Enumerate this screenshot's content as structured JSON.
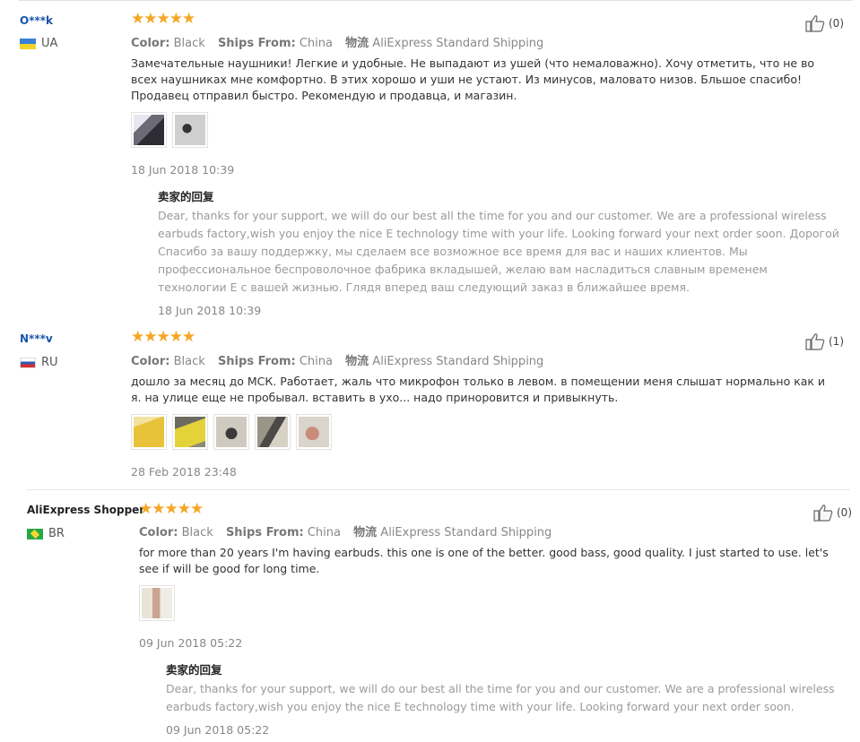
{
  "reviews": [
    {
      "user": "O***k",
      "country": "UA",
      "stars": "★★★★★",
      "color_label": "Color:",
      "color_value": "Black",
      "ships_label": "Ships From:",
      "ships_value": "China",
      "logistics_label": "物流",
      "logistics_value": "AliExpress Standard Shipping",
      "likes": "(0)",
      "text": "Замечательные наушники! Легкие и удобные. Не выпадают из ушей (что немаловажно). Хочу отметить, что не во всех наушниках мне комфортно. В этих хорошо и уши не устают. Из минусов, маловато низов. Бльшое спасибо! Продавец отправил быстро. Рекомендую и продавца, и магазин.",
      "date": "18 Jun 2018 10:39",
      "reply_title": "卖家的回复",
      "reply_text": "Dear, thanks for your support, we will do our best all the time for you and our customer. We are a professional wireless earbuds factory,wish you enjoy the nice E technology time with your life. Looking forward your next order soon. Дорогой Спасибо за вашу поддержку, мы сделаем все возможное все время для вас и наших клиентов. Мы профессиональное беспроволочное фабрика вкладышей, желаю вам насладиться славным временем технологии E с вашей жизнью. Глядя вперед ваш следующий заказ в ближайшее время.",
      "reply_date": "18 Jun 2018 10:39"
    },
    {
      "user": "N***v",
      "country": "RU",
      "stars": "★★★★★",
      "color_label": "Color:",
      "color_value": "Black",
      "ships_label": "Ships From:",
      "ships_value": "China",
      "logistics_label": "物流",
      "logistics_value": "AliExpress Standard Shipping",
      "likes": "(1)",
      "text": "дошло за месяц до МСК. Работает, жаль что микрофон только в левом. в помещении меня слышат нормально как и я. на улице еще не пробывал. вставить в ухо... надо приноровится и привыкнуть.",
      "date": "28 Feb 2018 23:48"
    },
    {
      "user": "AliExpress Shopper",
      "country": "BR",
      "stars": "★★★★★",
      "color_label": "Color:",
      "color_value": "Black",
      "ships_label": "Ships From:",
      "ships_value": "China",
      "logistics_label": "物流",
      "logistics_value": "AliExpress Standard Shipping",
      "likes": "(0)",
      "text": "for more than 20 years I'm having earbuds. this one is one of the better. good bass, good quality. I just started to use. let's see if will be good for long time.",
      "date": "09 Jun 2018 05:22",
      "reply_title": "卖家的回复",
      "reply_text": "Dear, thanks for your support, we will do our best all the time for you and our customer. We are a professional wireless earbuds factory,wish you enjoy the nice E technology time with your life. Looking forward your next order soon.",
      "reply_date": "09 Jun 2018 05:22"
    }
  ],
  "colors": {
    "star": "#f5a623",
    "username": "#1a55a8",
    "meta": "#888888"
  }
}
